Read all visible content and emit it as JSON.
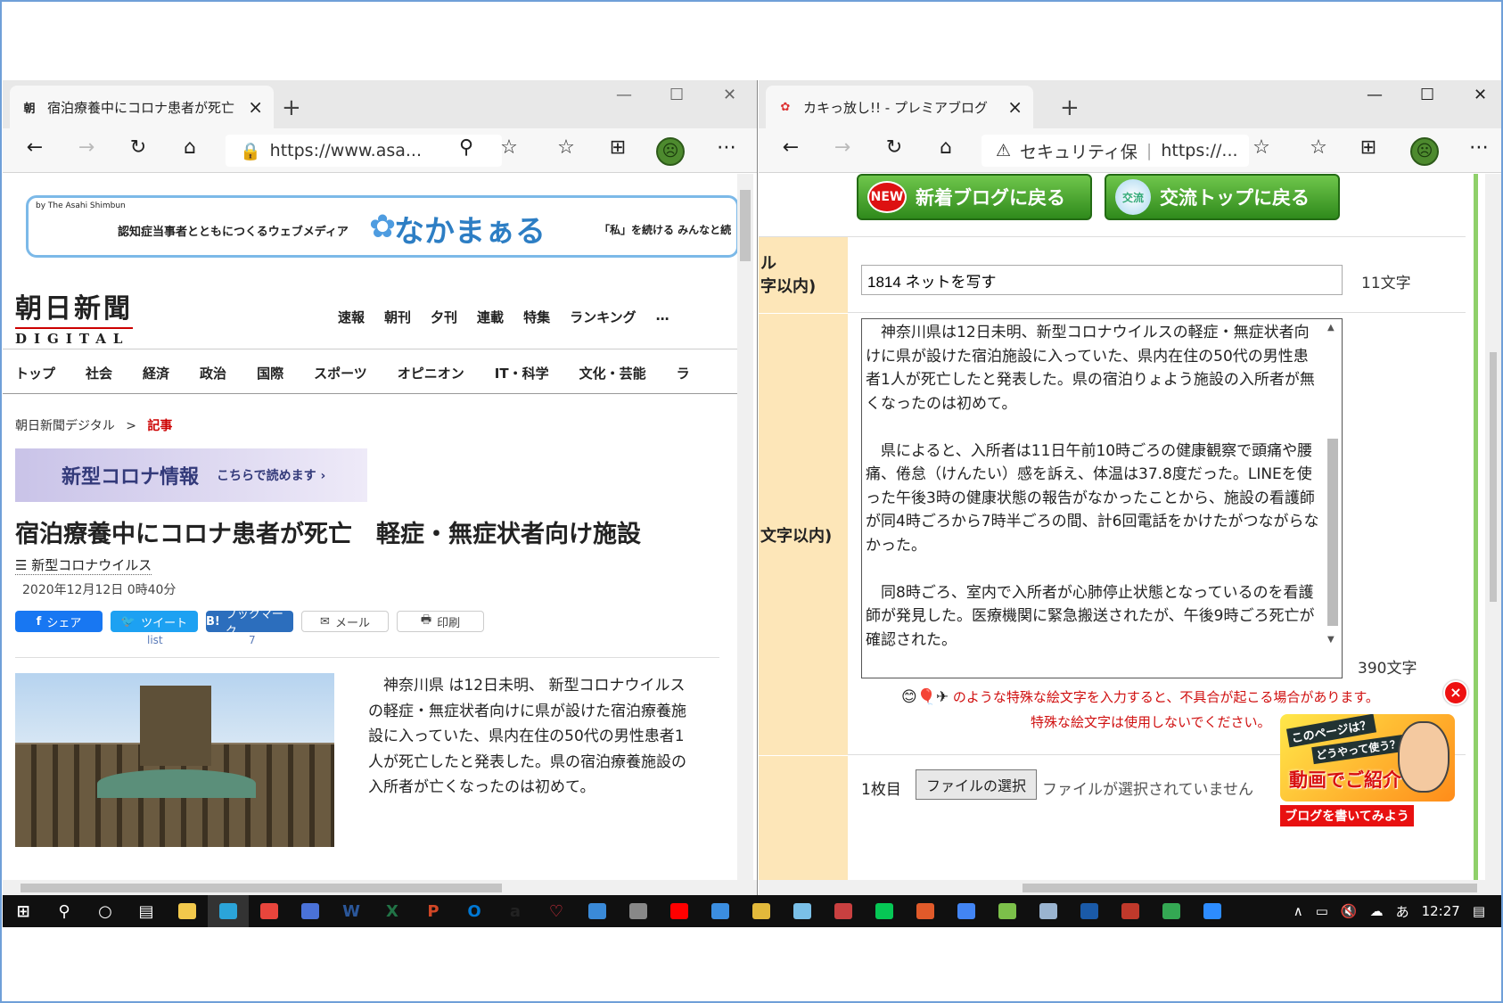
{
  "left_window": {
    "tab_favicon": "朝",
    "tab_title": "宿泊療養中にコロナ患者が死亡",
    "tab_close": "×",
    "new_tab": "+",
    "controls": {
      "minimize": "—",
      "maximize": "☐",
      "close": "✕"
    },
    "url": "https://www.asa...",
    "banner": {
      "by": "by The Asahi Shimbun",
      "subtitle": "認知症当事者とともにつくるウェブメディア",
      "logo": "なかまぁる",
      "tagline": "「私」を続ける みんなと続"
    },
    "masthead": {
      "title": "朝日新聞",
      "sub": "DIGITAL"
    },
    "top_nav": [
      "速報",
      "朝刊",
      "夕刊",
      "連載",
      "特集",
      "ランキング",
      "…"
    ],
    "category_nav": [
      "トップ",
      "社会",
      "経済",
      "政治",
      "国際",
      "スポーツ",
      "オピニオン",
      "IT・科学",
      "文化・芸能",
      "ラ"
    ],
    "breadcrumb": {
      "home": "朝日新聞デジタル",
      "sep": ">",
      "current": "記事"
    },
    "corona_banner": {
      "title": "新型コロナ情報",
      "link": "こちらで読めます ›"
    },
    "headline": "宿泊療養中にコロナ患者が死亡　軽症・無症状者向け施設",
    "tag_icon": "☰",
    "tag": "新型コロナウイルス",
    "date": "2020年12月12日 0時40分",
    "share_buttons": [
      {
        "icon": "f",
        "label": "シェア",
        "color": "#1877f2"
      },
      {
        "icon": "🐦",
        "label": "ツイート",
        "color": "#1da1f2"
      },
      {
        "icon": "B!",
        "label": "ブックマーク",
        "color": "#2c6ebd"
      },
      {
        "icon": "✉",
        "label": "メール",
        "color": "#ffffff"
      },
      {
        "icon": "🖶",
        "label": "印刷",
        "color": "#ffffff"
      }
    ],
    "tweet_count": "list",
    "bookmark_count": "7",
    "body": "　神奈川県 は12日未明、 新型コロナウイルス の軽症・無症状者向けに県が設けた宿泊療養施設に入っていた、県内在住の50代の男性患者1人が死亡したと発表した。県の宿泊療養施設の入所者が亡くなったのは初めて。"
  },
  "right_window": {
    "tab_title": "カキっ放し!! - プレミアブログ",
    "tab_close": "×",
    "new_tab": "+",
    "controls": {
      "minimize": "—",
      "maximize": "☐",
      "close": "✕"
    },
    "security_label": "セキュリティ保",
    "url": "https://...",
    "buttons": {
      "new_blog": "新着ブログに戻る",
      "new_badge": "NEW",
      "exchange": "交流トップに戻る",
      "exchange_badge": "交流"
    },
    "label_title": "ル\n字以内)",
    "label_body": "文字以内)",
    "title_value": "1814 ネットを写す",
    "title_count": "11文字",
    "body_text": "　神奈川県は12日未明、新型コロナウイルスの軽症・無症状者向けに県が設けた宿泊施設に入っていた、県内在住の50代の男性患者1人が死亡したと発表した。県の宿泊りょよう施設の入所者が無くなったのは初めて。\n\n　県によると、入所者は11日午前10時ごろの健康観察で頭痛や腰痛、倦怠（けんたい）感を訴え、体温は37.8度だった。LINEを使った午後3時の健康状態の報告がなかったことから、施設の看護師が同4時ごろから7時半ごろの間、計6回電話をかけたがつながらなかった。\n\n　同8時ごろ、室内で入所者が心肺停止状態となっているのを看護師が発見した。医療機関に緊急搬送されたが、午後9時ごろ死亡が確認された。",
    "body_count": "390文字",
    "warning_emoji": "😊🎈✈",
    "warning_1": "のような特殊な絵文字を入力すると、不具合が起こる場合があります。",
    "warning_2": "特殊な絵文字は使用しないでください。",
    "ad": {
      "line1": "このページは？",
      "line2": "どうやって使う？",
      "line3": "動画でご紹介",
      "bar": "ブログを書いてみよう",
      "close": "×"
    },
    "file": {
      "label": "1枚目",
      "button": "ファイルの選択",
      "status": "ファイルが選択されていません"
    }
  },
  "taskbar": {
    "clock": "12:27",
    "ime": "あ",
    "apps": [
      {
        "name": "windows-start-icon",
        "glyph": "⊞",
        "color": "#ffffff"
      },
      {
        "name": "search-icon",
        "glyph": "⚲",
        "color": "#ffffff"
      },
      {
        "name": "cortana-icon",
        "glyph": "○",
        "color": "#ffffff"
      },
      {
        "name": "task-view-icon",
        "glyph": "▤",
        "color": "#ffffff"
      },
      {
        "name": "file-explorer-icon",
        "glyph": "",
        "color": "#f2c94c"
      },
      {
        "name": "edge-icon",
        "glyph": "",
        "color": "#2ba4d9"
      },
      {
        "name": "chrome-icon",
        "glyph": "",
        "color": "#e8453c"
      },
      {
        "name": "people-icon",
        "glyph": "",
        "color": "#4a72d8"
      },
      {
        "name": "word-icon",
        "glyph": "W",
        "color": "#2b579a"
      },
      {
        "name": "excel-icon",
        "glyph": "X",
        "color": "#217346"
      },
      {
        "name": "powerpoint-icon",
        "glyph": "P",
        "color": "#d24726"
      },
      {
        "name": "outlook-icon",
        "glyph": "O",
        "color": "#0078d4"
      },
      {
        "name": "amazon-icon",
        "glyph": "a",
        "color": "#222222"
      },
      {
        "name": "iris-icon",
        "glyph": "♡",
        "color": "#e03040"
      },
      {
        "name": "calculator-icon",
        "glyph": "",
        "color": "#3a8ad8"
      },
      {
        "name": "printer-icon",
        "glyph": "",
        "color": "#888888"
      },
      {
        "name": "youtube-icon",
        "glyph": "",
        "color": "#ff0000"
      },
      {
        "name": "photos-icon",
        "glyph": "",
        "color": "#3b8ee0"
      },
      {
        "name": "paint-icon",
        "glyph": "",
        "color": "#e2b93b"
      },
      {
        "name": "palette-icon",
        "glyph": "",
        "color": "#7ac0e8"
      },
      {
        "name": "app-icon",
        "glyph": "",
        "color": "#c94040"
      },
      {
        "name": "line-icon",
        "glyph": "",
        "color": "#06c755"
      },
      {
        "name": "character-icon",
        "glyph": "",
        "color": "#e05a2a"
      },
      {
        "name": "google-icon",
        "glyph": "",
        "color": "#4285f4"
      },
      {
        "name": "blog-icon",
        "glyph": "",
        "color": "#7cc04a"
      },
      {
        "name": "scanner-icon",
        "glyph": "",
        "color": "#9ab4d0"
      },
      {
        "name": "sphere-icon",
        "glyph": "",
        "color": "#1a5aa8"
      },
      {
        "name": "pdf-icon",
        "glyph": "",
        "color": "#c0392b"
      },
      {
        "name": "play-store-icon",
        "glyph": "",
        "color": "#34a853"
      },
      {
        "name": "zoom-icon",
        "glyph": "",
        "color": "#2d8cff"
      }
    ]
  }
}
